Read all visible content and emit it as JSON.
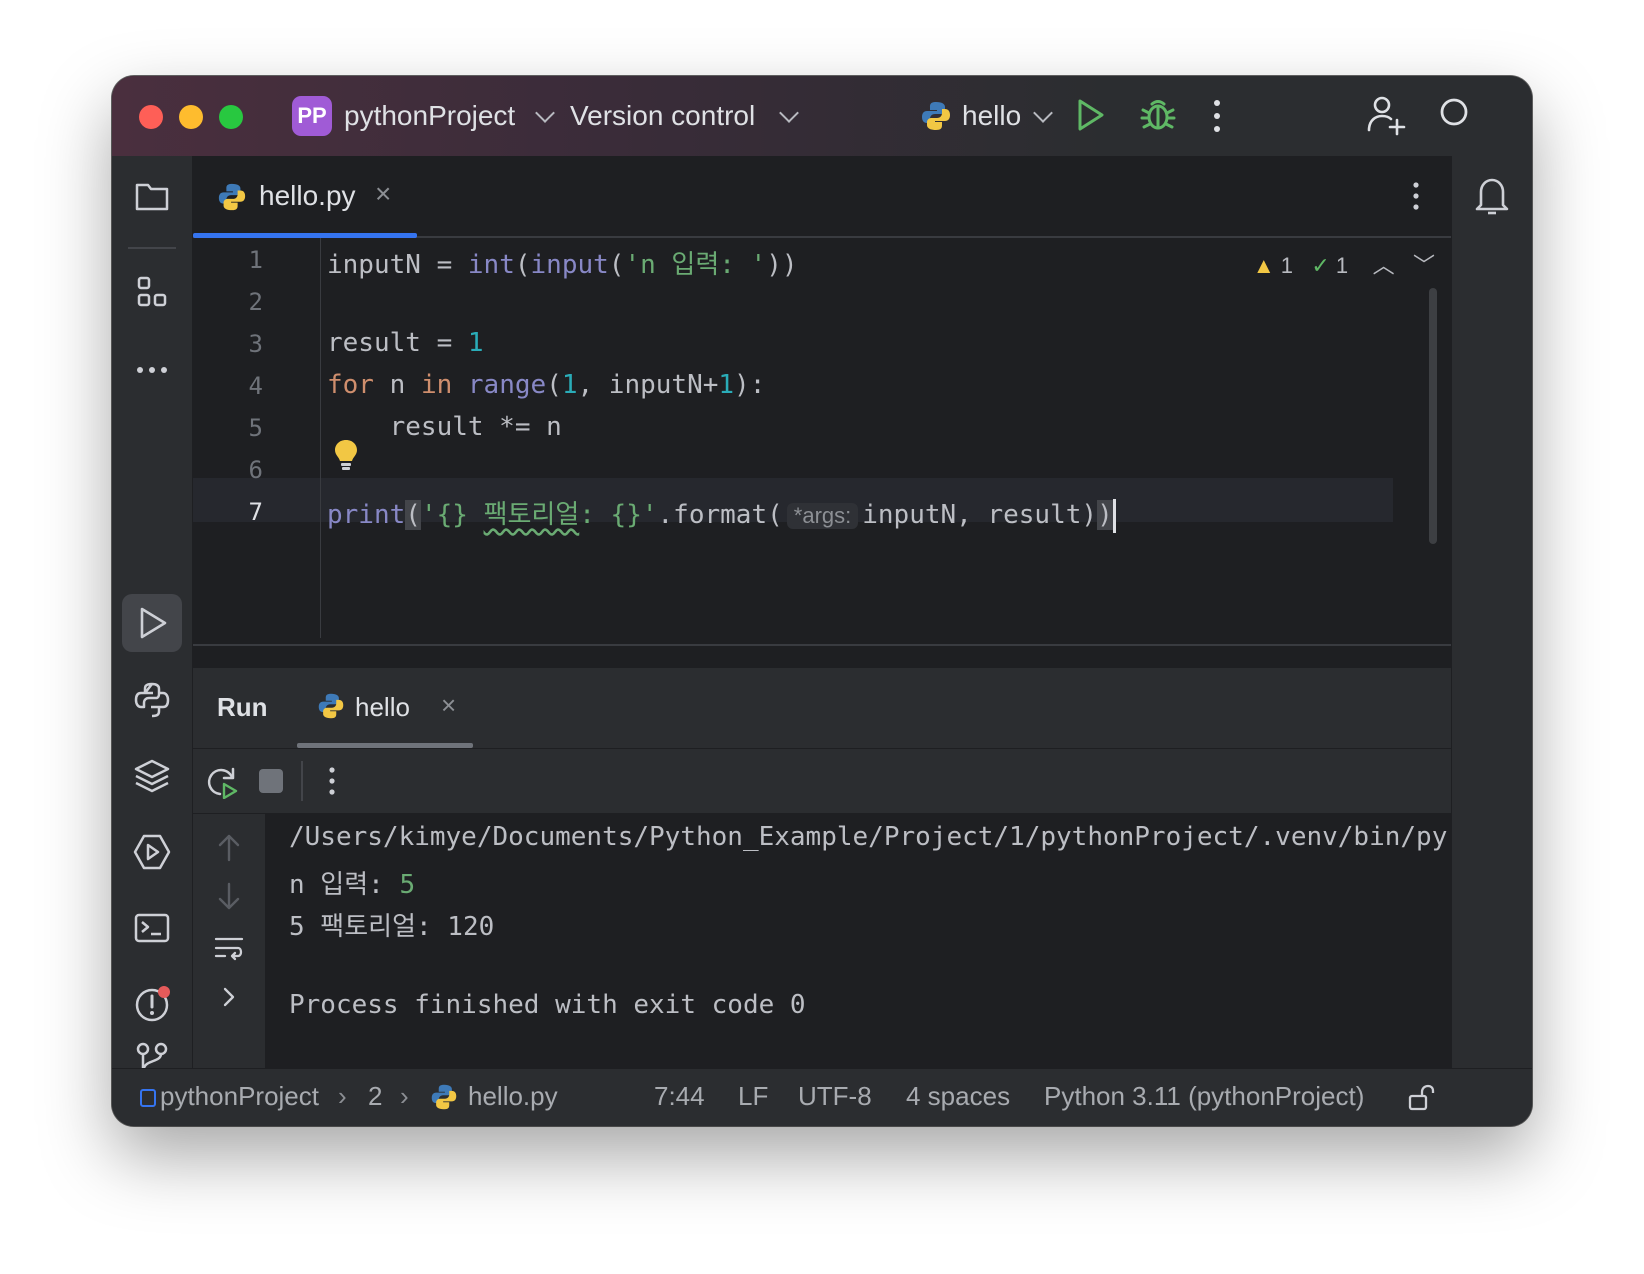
{
  "titlebar": {
    "project_badge": "PP",
    "project_name": "pythonProject",
    "vcs_label": "Version control",
    "run_config": "hello"
  },
  "editor": {
    "tab_label": "hello.py",
    "tab_close": "×",
    "line_numbers": [
      "1",
      "2",
      "3",
      "4",
      "5",
      "6",
      "7"
    ],
    "inspections": {
      "warnings": "1",
      "checks": "1"
    },
    "param_hint": "*args:",
    "lines": {
      "l1": {
        "a": "inputN = ",
        "b": "int",
        "c": "(",
        "d": "input",
        "e": "(",
        "f": "'n 입력: '",
        "g": "))"
      },
      "l3": {
        "a": "result = ",
        "b": "1"
      },
      "l4": {
        "a": "for",
        "b": " n ",
        "c": "in",
        "d": " ",
        "e": "range",
        "f": "(",
        "g": "1",
        "h": ", inputN+",
        "i": "1",
        "j": "):"
      },
      "l5": {
        "a": "    result *= n"
      },
      "l7": {
        "a": "print",
        "b": "(",
        "c": "'{} ",
        "d": "팩토리얼",
        "e": ": {}'",
        "f": ".format(",
        "g": "inputN, result)",
        "h": ")"
      }
    }
  },
  "run": {
    "title": "Run",
    "tab_label": "hello",
    "tab_close": "×",
    "output": [
      "/Users/kimye/Documents/Python_Example/Project/1/pythonProject/.venv/bin/py",
      "n 입력: ",
      "5",
      "5 팩토리얼: 120",
      "Process finished with exit code 0"
    ]
  },
  "statusbar": {
    "project": "pythonProject",
    "folder": "2",
    "file": "hello.py",
    "position": "7:44",
    "line_ending": "LF",
    "encoding": "UTF-8",
    "indent": "4 spaces",
    "interpreter": "Python 3.11 (pythonProject)"
  },
  "colors": {
    "accent": "#3574f0",
    "run_green": "#5fb865",
    "keyword": "#cf8e6d",
    "string": "#6aab73",
    "number": "#2aacb8",
    "builtin": "#8888c6"
  },
  "icons": [
    "python-icon",
    "run-icon",
    "debug-icon",
    "more-icon",
    "add-user-icon",
    "search-icon",
    "folder-icon",
    "structure-icon",
    "python-console-icon",
    "layers-icon",
    "services-icon",
    "terminal-icon",
    "problems-icon",
    "git-icon",
    "bell-icon",
    "rerun-icon",
    "stop-icon",
    "arrow-up-icon",
    "arrow-down-icon",
    "soft-wrap-icon",
    "lock-icon",
    "bulb-icon"
  ]
}
